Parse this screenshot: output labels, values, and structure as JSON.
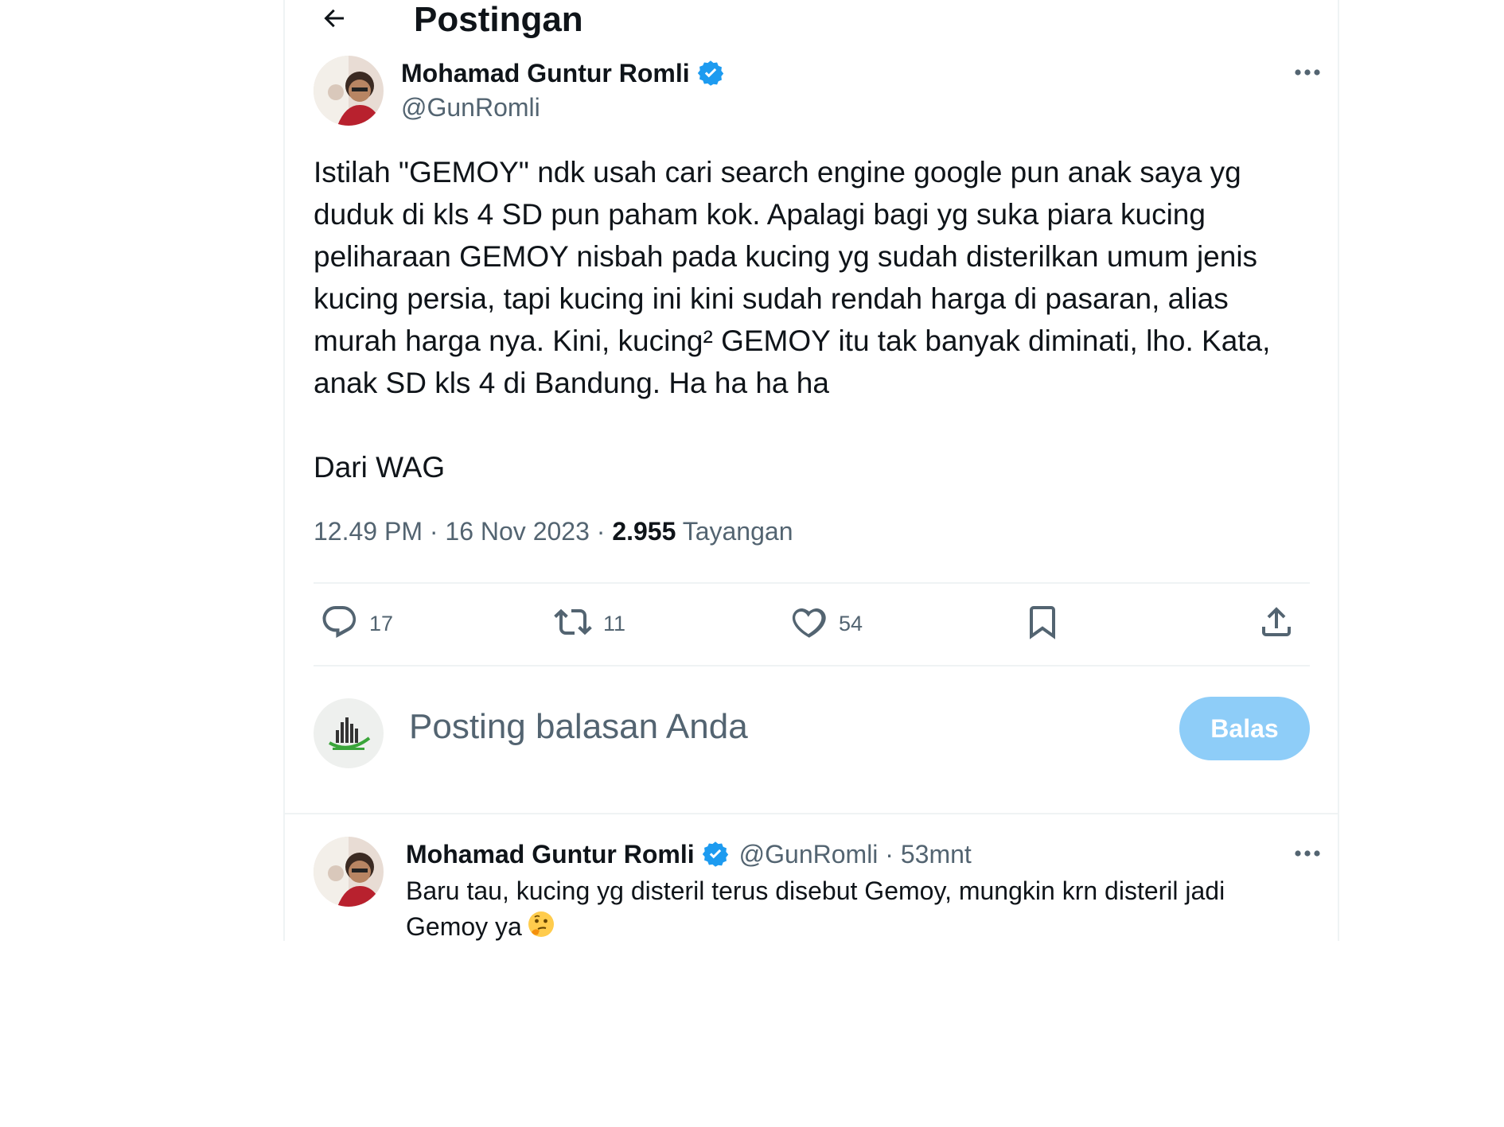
{
  "header": {
    "title": "Postingan"
  },
  "post": {
    "author_name": "Mohamad Guntur Romli",
    "handle": "@GunRomli",
    "text": "Istilah \"GEMOY\" ndk usah cari search engine google pun anak saya yg duduk di kls 4 SD pun paham kok. Apalagi bagi yg suka piara kucing peliharaan GEMOY nisbah pada kucing yg sudah disterilkan umum jenis kucing persia, tapi kucing ini kini sudah rendah harga di pasaran, alias murah harga nya. Kini, kucing² GEMOY itu tak banyak diminati, lho. Kata, anak SD kls 4 di Bandung. Ha ha ha ha\n\nDari WAG",
    "time": "12.49 PM",
    "date": "16 Nov 2023",
    "views_count": "2.955",
    "views_label": "Tayangan",
    "replies": "17",
    "reposts": "11",
    "likes": "54"
  },
  "compose": {
    "placeholder": "Posting balasan Anda",
    "button_label": "Balas"
  },
  "reply": {
    "author_name": "Mohamad Guntur Romli",
    "handle": "@GunRomli",
    "time_ago": "53mnt",
    "text": "Baru tau, kucing yg disteril terus disebut Gemoy, mungkin krn disteril jadi Gemoy ya"
  },
  "icons": {
    "back": "arrow-left-icon",
    "verified": "verified-badge-icon",
    "more": "more-horizontal-icon",
    "reply": "comment-icon",
    "repost": "repost-icon",
    "like": "heart-icon",
    "bookmark": "bookmark-icon",
    "share": "share-icon",
    "emoji": "thinking-face-emoji"
  },
  "colors": {
    "accent": "#1d9bf0",
    "reply_button": "#8ecdf8",
    "secondary_text": "#536471",
    "divider": "#eff3f4"
  }
}
